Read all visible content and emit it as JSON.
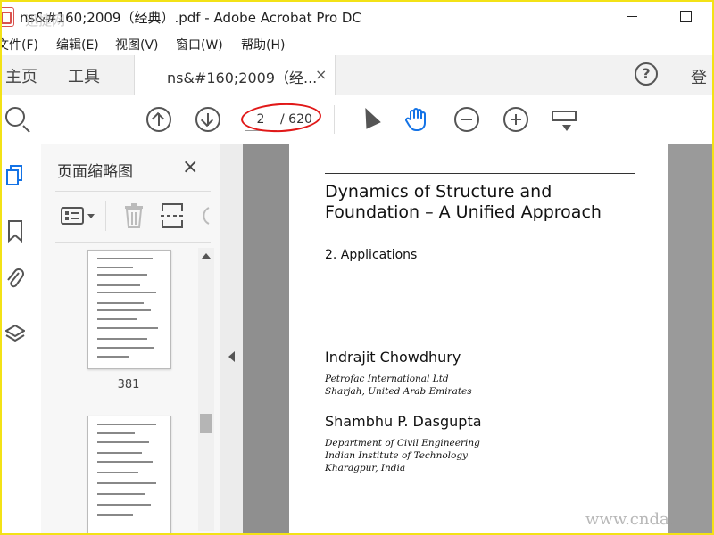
{
  "window": {
    "title": "ns&#160;2009（经典）.pdf - Adobe Acrobat Pro DC",
    "watermark_top": "迅捷网"
  },
  "menu": [
    "文件(F)",
    "编辑(E)",
    "视图(V)",
    "窗口(W)",
    "帮助(H)"
  ],
  "tabs": {
    "home": "主页",
    "tools": "工具",
    "document": "ns&#160;2009（经...",
    "close_glyph": "×",
    "help_glyph": "?",
    "signin": "登"
  },
  "toolbar": {
    "page_current": "2",
    "page_total": "/ 620"
  },
  "thumbnails": {
    "title": "页面缩略图",
    "close_glyph": "×",
    "items": [
      {
        "label": "381"
      },
      {
        "label": ""
      }
    ]
  },
  "document": {
    "title": "Dynamics of Structure and Foundation – A Unified Approach",
    "subtitle": "2. Applications",
    "authors": [
      {
        "name": "Indrajit Chowdhury",
        "affiliation": [
          "Petrofac International Ltd",
          "Sharjah, United Arab Emirates"
        ]
      },
      {
        "name": "Shambhu P. Dasgupta",
        "affiliation": [
          "Department of Civil Engineering",
          "Indian Institute of Technology",
          "Kharagpur, India"
        ]
      }
    ]
  },
  "watermark_bottom": "www.cndao.",
  "colors": {
    "frame": "#f3e216",
    "highlight_ellipse": "#e11818",
    "hand_tool": "#1473e6"
  },
  "icons": [
    "search-icon",
    "arrow-up-icon",
    "arrow-down-icon",
    "pointer-icon",
    "hand-icon",
    "zoom-out-icon",
    "zoom-in-icon",
    "marquee-icon",
    "help-icon",
    "pages-icon",
    "bookmark-icon",
    "attachment-icon",
    "layers-icon",
    "options-icon",
    "trash-icon",
    "extract-icon",
    "rotate-icon"
  ]
}
